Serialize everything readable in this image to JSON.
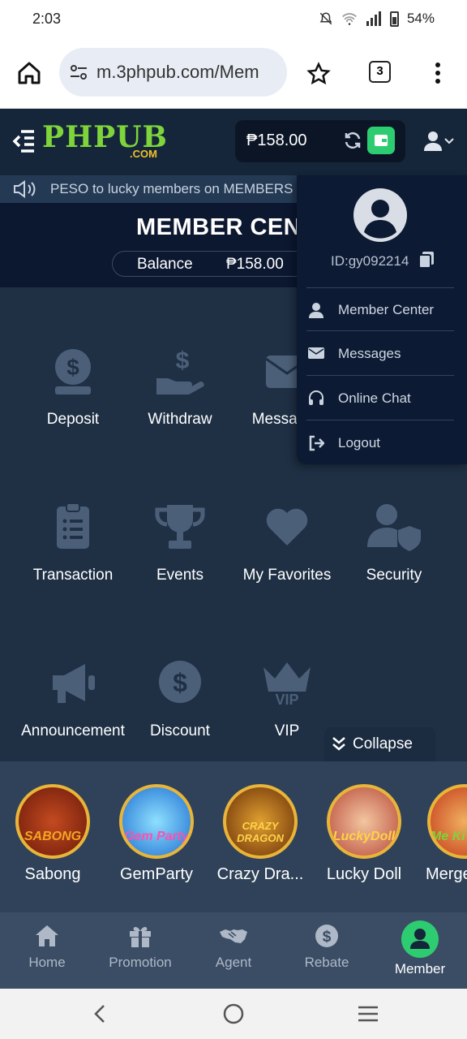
{
  "status_bar": {
    "time": "2:03",
    "battery": "54%"
  },
  "browser": {
    "url": "m.3phpub.com/Mem",
    "tab_count": "3"
  },
  "header": {
    "logo_main": "PHPUB",
    "logo_sub": ".COM",
    "balance": "₱158.00"
  },
  "marquee": {
    "text": "PESO to lucky members on MEMBERS"
  },
  "banner": {
    "title": "MEMBER CENTER",
    "balance_label": "Balance",
    "balance_value": "₱158.00"
  },
  "grid": {
    "items": [
      {
        "label": "Deposit",
        "icon": "deposit-icon"
      },
      {
        "label": "Withdraw",
        "icon": "withdraw-icon"
      },
      {
        "label": "Messages",
        "icon": "envelope-icon"
      },
      {
        "label": "Transaction",
        "icon": "clipboard-icon"
      },
      {
        "label": "Events",
        "icon": "trophy-icon"
      },
      {
        "label": "My Favorites",
        "icon": "heart-icon"
      },
      {
        "label": "Security",
        "icon": "user-shield-icon"
      },
      {
        "label": "Announcement",
        "icon": "megaphone-icon"
      },
      {
        "label": "Discount",
        "icon": "dollar-coin-icon"
      },
      {
        "label": "VIP",
        "icon": "vip-crown-icon"
      }
    ],
    "collapse_label": "Collapse"
  },
  "games": [
    {
      "label": "Sabong",
      "logo": "SABONG",
      "badge": "Y",
      "bg": "#8a2a10"
    },
    {
      "label": "GemParty",
      "logo": "Gem Party",
      "badge": "T",
      "bg": "#1f6fd1"
    },
    {
      "label": "Crazy Dra...",
      "logo": "CRAZY DRAGON",
      "badge": "T",
      "bg": "#7a3a10"
    },
    {
      "label": "Lucky Doll",
      "logo": "LuckyDoll",
      "badge": "Y",
      "bg": "#b84a3a"
    },
    {
      "label": "Merge",
      "logo": "Me Ki",
      "badge": "T",
      "bg": "#c43a1a"
    }
  ],
  "bottom_nav": [
    {
      "label": "Home",
      "icon": "home-icon"
    },
    {
      "label": "Promotion",
      "icon": "gift-icon"
    },
    {
      "label": "Agent",
      "icon": "handshake-icon"
    },
    {
      "label": "Rebate",
      "icon": "dollar-icon"
    },
    {
      "label": "Member",
      "icon": "member-icon"
    }
  ],
  "dropdown": {
    "user_id": "ID:gy092214",
    "items": [
      {
        "label": "Member Center",
        "icon": "user-icon"
      },
      {
        "label": "Messages",
        "icon": "envelope-icon"
      },
      {
        "label": "Online Chat",
        "icon": "headset-icon"
      },
      {
        "label": "Logout",
        "icon": "logout-icon"
      }
    ]
  },
  "colors": {
    "accent_green": "#2ecc71",
    "logo_green": "#7ed43a",
    "header_bg": "#15263a",
    "dropdown_bg": "#0d1a33"
  }
}
